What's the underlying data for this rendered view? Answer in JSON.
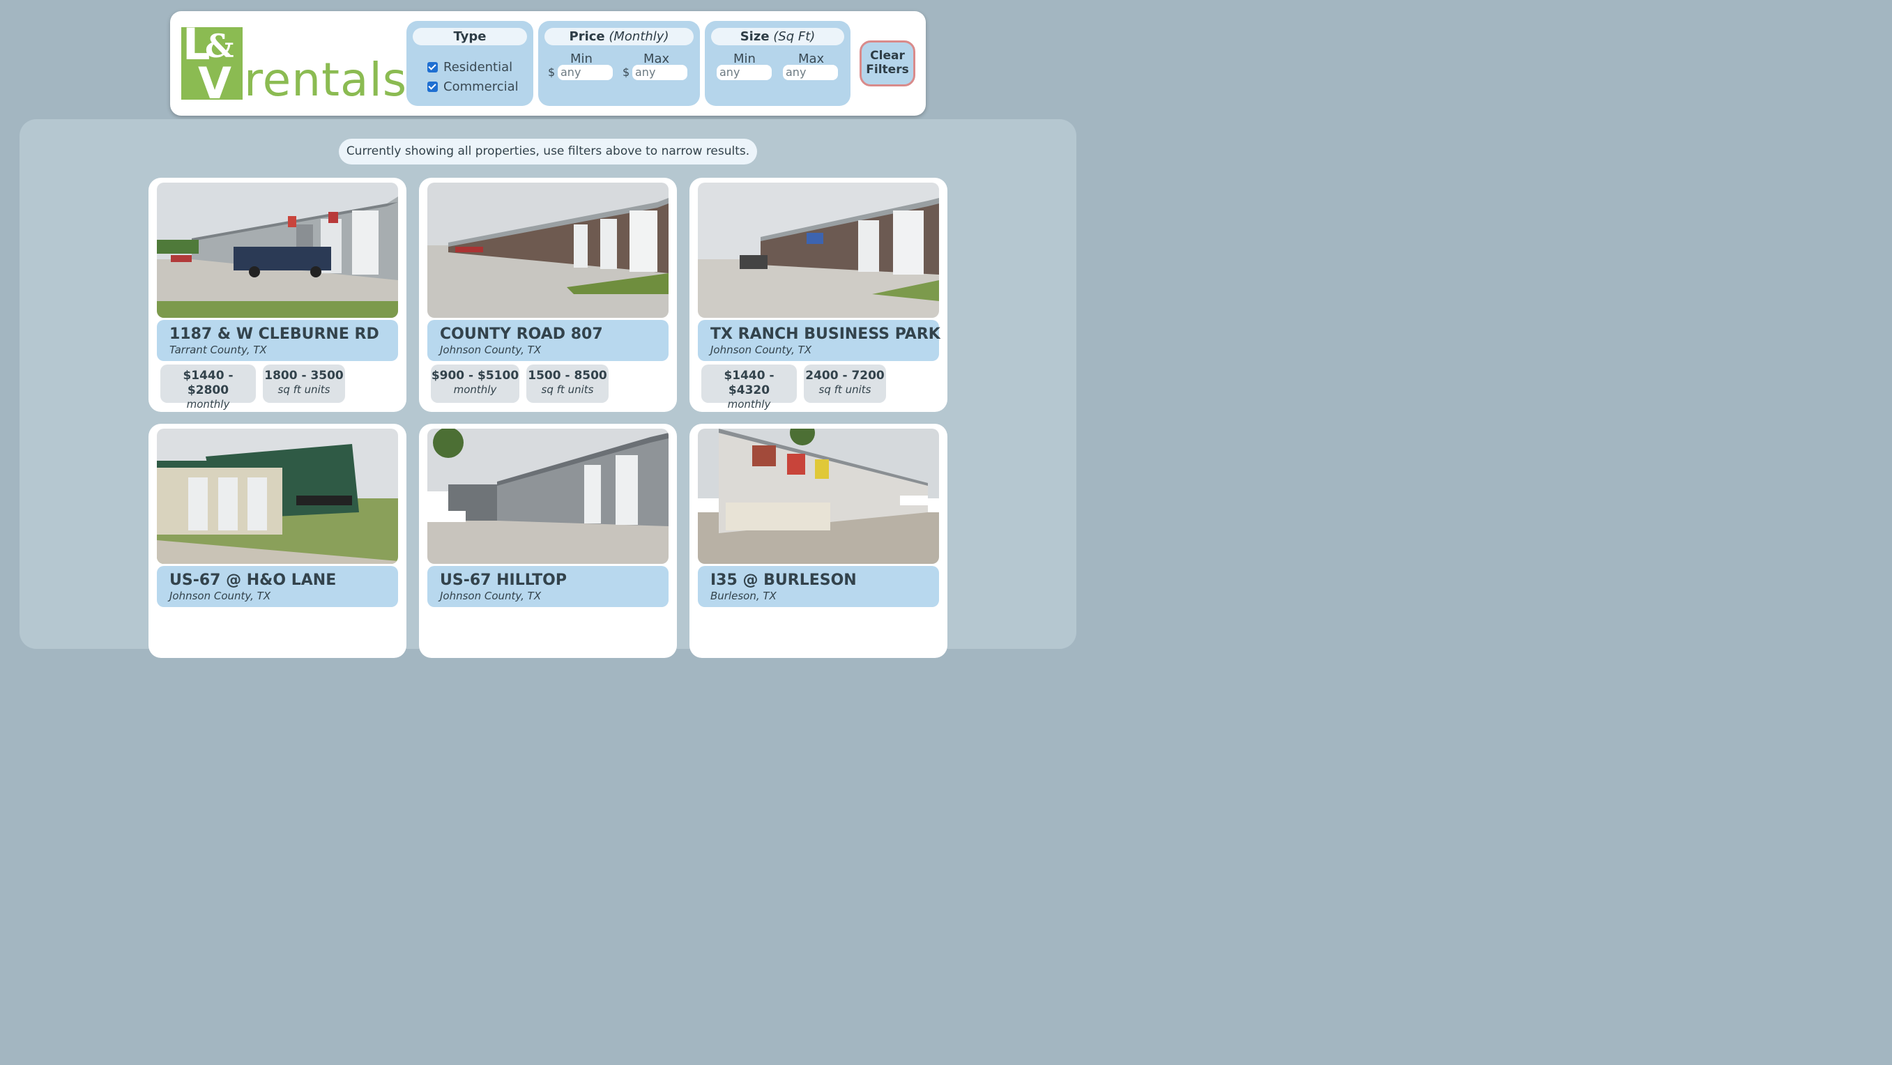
{
  "logo": {
    "letters_top": "L&",
    "letter_bottom": "V",
    "word": "rentals"
  },
  "filters": {
    "type": {
      "title": "Type",
      "options": [
        {
          "label": "Residential",
          "checked": true
        },
        {
          "label": "Commercial",
          "checked": true
        }
      ]
    },
    "price": {
      "title": "Price",
      "title_note": "(Monthly)",
      "min_label": "Min",
      "max_label": "Max",
      "currency": "$",
      "min_placeholder": "any",
      "max_placeholder": "any"
    },
    "size": {
      "title": "Size",
      "title_note": "(Sq Ft)",
      "min_label": "Min",
      "max_label": "Max",
      "min_placeholder": "any",
      "max_placeholder": "any"
    },
    "clear_line1": "Clear",
    "clear_line2": "Filters"
  },
  "notice": "Currently showing all properties, use filters above to narrow results.",
  "properties": [
    {
      "name": "1187 & W CLEBURNE RD",
      "location": "Tarrant County, TX",
      "price": "$1440 - $2800",
      "price_unit": "monthly",
      "size": "1800 - 3500",
      "size_unit": "sq ft units"
    },
    {
      "name": "COUNTY ROAD 807",
      "location": "Johnson County, TX",
      "price": "$900 - $5100",
      "price_unit": "monthly",
      "size": "1500 - 8500",
      "size_unit": "sq ft units"
    },
    {
      "name": "TX RANCH BUSINESS PARK",
      "location": "Johnson County, TX",
      "price": "$1440 - $4320",
      "price_unit": "monthly",
      "size": "2400 - 7200",
      "size_unit": "sq ft units"
    },
    {
      "name": "US-67 @ H&O LANE",
      "location": "Johnson County, TX"
    },
    {
      "name": "US-67 HILLTOP",
      "location": "Johnson County, TX"
    },
    {
      "name": "I35 @ BURLESON",
      "location": "Burleson, TX"
    }
  ],
  "colors": {
    "background": "#a3b6c1",
    "panel": "#b5c7d0",
    "filter_box": "#b5d5eb",
    "brand_green": "#8bbb52",
    "clear_border": "#d98b8b",
    "checkbox": "#1f6fd1"
  }
}
